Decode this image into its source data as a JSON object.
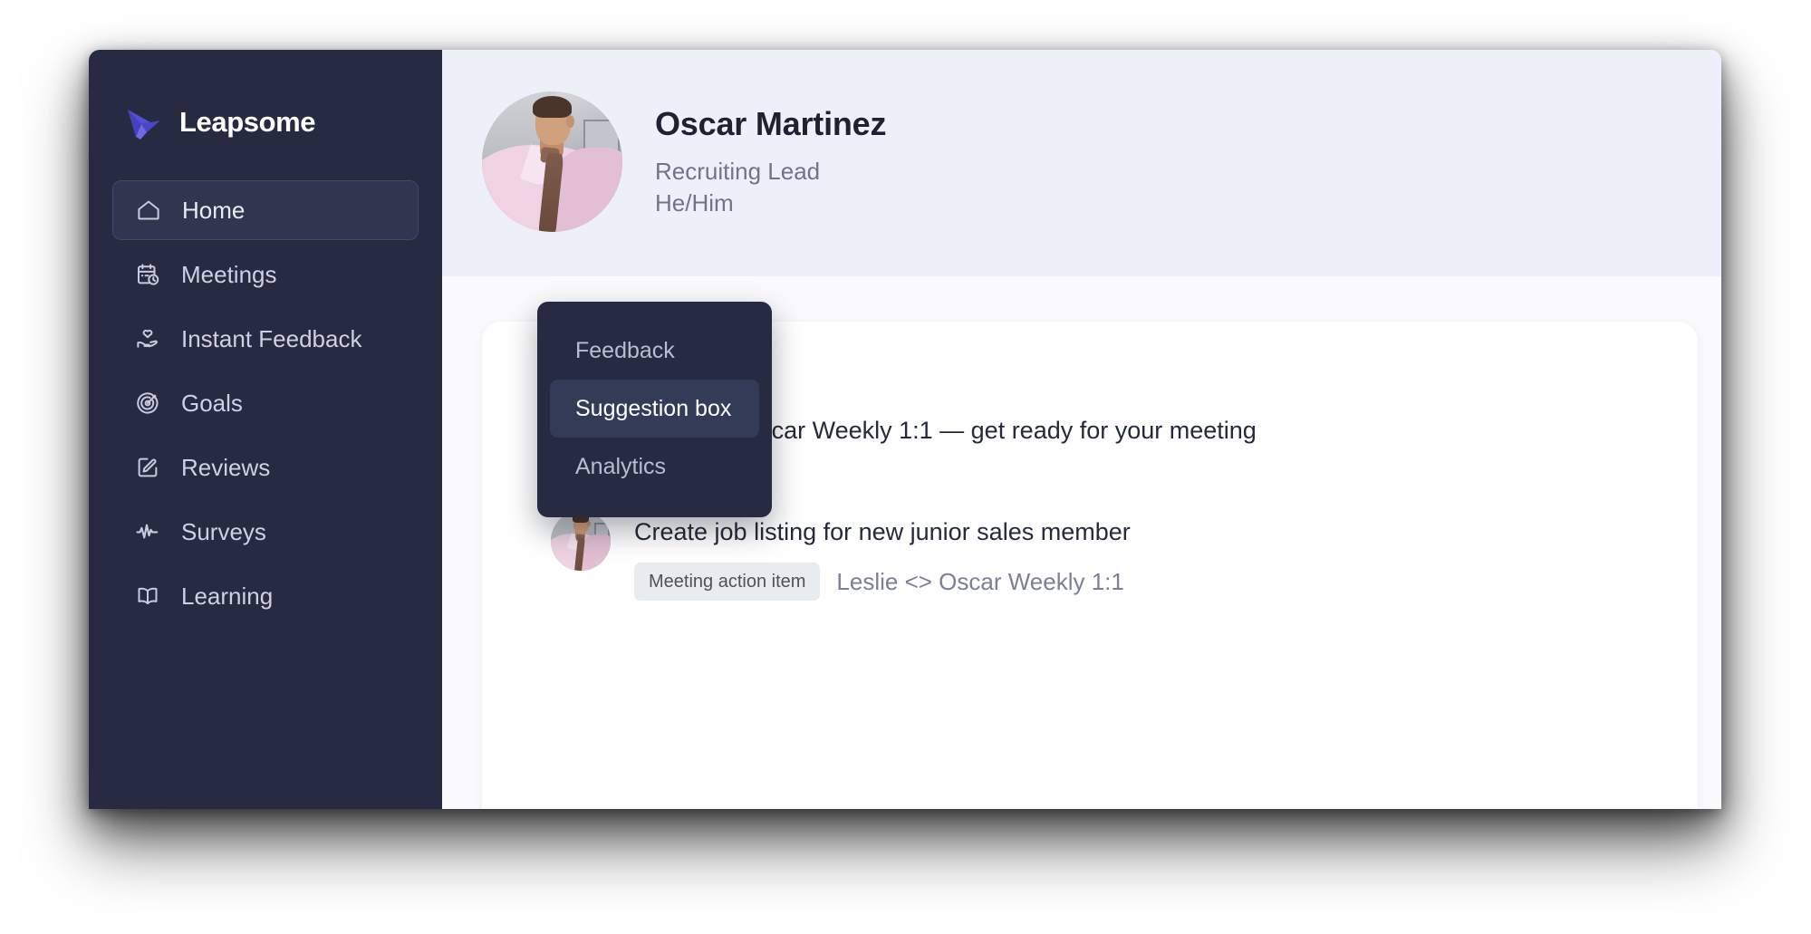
{
  "brand": {
    "name": "Leapsome",
    "logo_icon": "bird-logo-icon",
    "logo_color": "#5551d6"
  },
  "sidebar": {
    "background_color": "#262b42",
    "items": [
      {
        "label": "Home",
        "icon": "home-icon",
        "active": true
      },
      {
        "label": "Meetings",
        "icon": "calendar-clock-icon",
        "active": false
      },
      {
        "label": "Instant Feedback",
        "icon": "heart-in-hand-icon",
        "active": false
      },
      {
        "label": "Goals",
        "icon": "target-arrow-icon",
        "active": false
      },
      {
        "label": "Reviews",
        "icon": "pencil-square-icon",
        "active": false
      },
      {
        "label": "Surveys",
        "icon": "pulse-line-icon",
        "active": false
      },
      {
        "label": "Learning",
        "icon": "open-book-icon",
        "active": false
      }
    ]
  },
  "dropdown": {
    "items": [
      {
        "label": "Feedback",
        "selected": false
      },
      {
        "label": "Suggestion box",
        "selected": true
      },
      {
        "label": "Analytics",
        "selected": false
      }
    ],
    "selected_background": "#343b57"
  },
  "profile": {
    "avatar_icon": "user-avatar",
    "name": "Oscar Martinez",
    "role": "Recruiting Lead",
    "pronouns": "He/Him",
    "header_background": "#eef0f9"
  },
  "feed": {
    "items": [
      {
        "avatar_icon": "user-avatar",
        "title": "Leslie <> Oscar Weekly 1:1 — get ready for your meeting",
        "badge": "",
        "meta": ""
      },
      {
        "avatar_icon": "user-avatar",
        "title": "Create job listing for new junior sales member",
        "badge": "Meeting action item",
        "meta": "Leslie <> Oscar Weekly 1:1"
      }
    ]
  }
}
